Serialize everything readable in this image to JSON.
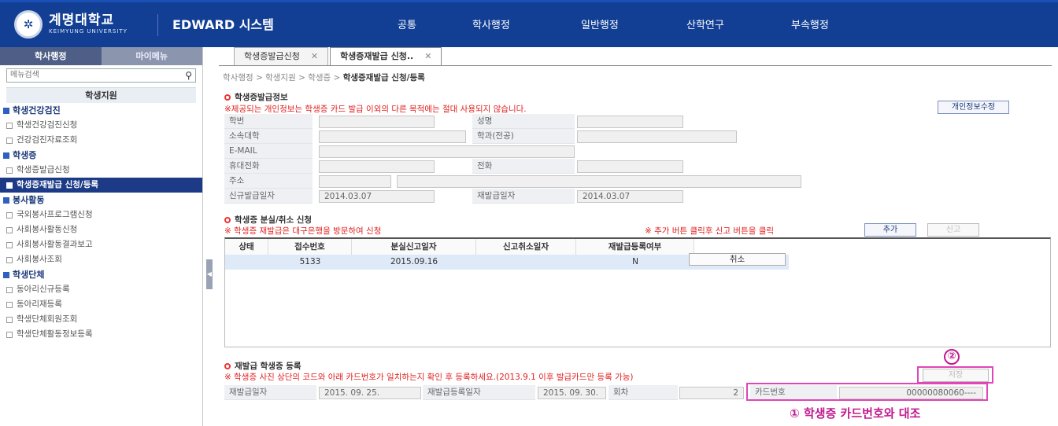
{
  "header": {
    "logo_ko": "계명대학교",
    "logo_en": "KEIMYUNG UNIVERSITY",
    "system_title": "EDWARD 시스템",
    "nav": [
      "공통",
      "학사행정",
      "일반행정",
      "산학연구",
      "부속행정"
    ]
  },
  "sidebar": {
    "tabs": [
      "학사행정",
      "마이메뉴"
    ],
    "search_placeholder": "메뉴검색",
    "title": "학생지원",
    "groups": [
      {
        "label": "학생건강검진",
        "items": [
          "학생건강검진신청",
          "건강검진자료조회"
        ]
      },
      {
        "label": "학생증",
        "items": [
          "학생증발급신청",
          "학생증재발급 신청/등록"
        ]
      },
      {
        "label": "봉사활동",
        "items": [
          "국외봉사프로그램신청",
          "사회봉사활동신청",
          "사회봉사활동결과보고",
          "사회봉사조회"
        ]
      },
      {
        "label": "학생단체",
        "items": [
          "동아리신규등록",
          "동아리재등록",
          "학생단체회원조회",
          "학생단체활동정보등록"
        ]
      }
    ]
  },
  "tabs": [
    "학생증발급신청",
    "학생증재발급 신청.."
  ],
  "breadcrumb": {
    "path": "학사행정 > 학생지원 > 학생증 > ",
    "current": "학생증재발급 신청/등록"
  },
  "info": {
    "title": "학생증발급정보",
    "notice": "※제공되는 개인정보는 학생증 카드 발급 이외의 다른 목적에는 절대 사용되지 않습니다.",
    "edit_button": "개인정보수정",
    "labels": {
      "student_no": "학번",
      "name": "성명",
      "college": "소속대학",
      "dept": "학과(전공)",
      "email": "E-MAIL",
      "mobile": "휴대전화",
      "phone": "전화",
      "address": "주소",
      "first_issue": "신규발급일자",
      "reissue": "재발급일자"
    },
    "values": {
      "first_issue": "2014.03.07",
      "reissue": "2014.03.07"
    }
  },
  "lost": {
    "title": "학생증 분실/취소 신청",
    "notice": "※ 학생증 재발급은 대구은행을 방문하여 신청",
    "hint": "※ 추가 버튼 클릭후 신고 버튼을 클릭",
    "add_button": "추가",
    "report_button": "신고",
    "columns": [
      "상태",
      "접수번호",
      "분실신고일자",
      "신고취소일자",
      "재발급등록여부"
    ],
    "row": {
      "status": "",
      "receipt_no": "5133",
      "report_date": "2015.09.16",
      "cancel_date": "",
      "registered": "N",
      "action": "취소"
    }
  },
  "reissue": {
    "title": "재발급 학생증 등록",
    "notice": "※ 학생증 사진 상단의 코드와 아래 카드번호가 일치하는지 확인 후 등록하세요.(2013.9.1 이후 발급카드만 등록 가능)",
    "save_button": "저장",
    "labels": {
      "reissue_date": "재발급일자",
      "reg_date": "재발급등록일자",
      "count": "회차",
      "card_no": "카드번호"
    },
    "values": {
      "reissue_date": "2015. 09. 25.",
      "reg_date": "2015. 09. 30.",
      "count": "2",
      "card_no": "00000080060----"
    }
  },
  "annotations": {
    "circle_1": "①",
    "circle_2": "②",
    "note": "학생증 카드번호와 대조"
  },
  "colors": {
    "header_bg": "#123f94",
    "highlight": "#e046b8",
    "notice_red": "#e02020"
  }
}
